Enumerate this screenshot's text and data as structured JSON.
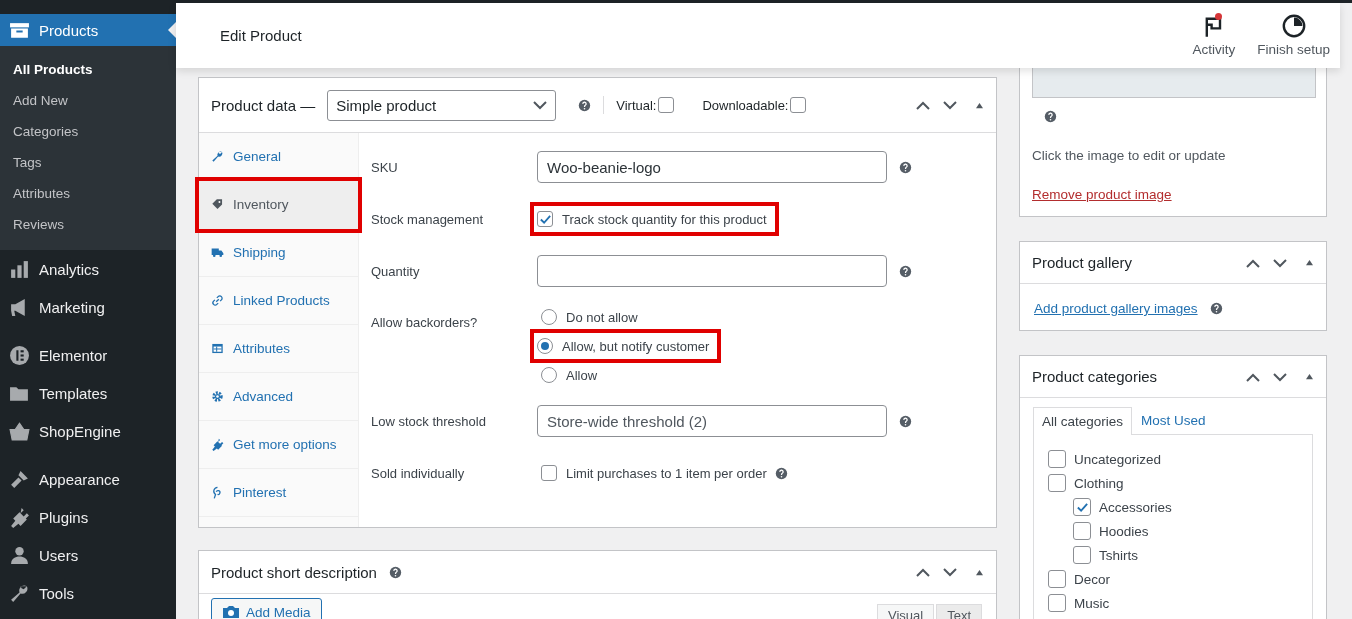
{
  "sidebar": {
    "groups": [
      {
        "items": [
          {
            "label": "Products",
            "selected": true,
            "submenu": [
              {
                "label": "All Products",
                "selected": true
              },
              {
                "label": "Add New",
                "selected": false
              },
              {
                "label": "Categories",
                "selected": false
              },
              {
                "label": "Tags",
                "selected": false
              },
              {
                "label": "Attributes",
                "selected": false
              },
              {
                "label": "Reviews",
                "selected": false
              }
            ]
          },
          {
            "label": "Analytics",
            "selected": false
          },
          {
            "label": "Marketing",
            "selected": false
          }
        ]
      },
      {
        "items": [
          {
            "label": "Elementor",
            "selected": false
          },
          {
            "label": "Templates",
            "selected": false
          },
          {
            "label": "ShopEngine",
            "selected": false
          }
        ]
      },
      {
        "items": [
          {
            "label": "Appearance",
            "selected": false
          },
          {
            "label": "Plugins",
            "selected": false
          },
          {
            "label": "Users",
            "selected": false
          },
          {
            "label": "Tools",
            "selected": false
          }
        ]
      }
    ]
  },
  "header": {
    "title": "Edit Product",
    "actions": [
      {
        "label": "Activity",
        "badge": true
      },
      {
        "label": "Finish setup",
        "badge": false
      }
    ]
  },
  "product_data": {
    "title": "Product data —",
    "type_select": "Simple product",
    "virtual": {
      "label": "Virtual:",
      "checked": false
    },
    "downloadable": {
      "label": "Downloadable:",
      "checked": false
    },
    "tabs": [
      {
        "label": "General",
        "selected": false,
        "highlighted": false
      },
      {
        "label": "Inventory",
        "selected": true,
        "highlighted": true
      },
      {
        "label": "Shipping",
        "selected": false,
        "highlighted": false
      },
      {
        "label": "Linked Products",
        "selected": false,
        "highlighted": false
      },
      {
        "label": "Attributes",
        "selected": false,
        "highlighted": false
      },
      {
        "label": "Advanced",
        "selected": false,
        "highlighted": false
      },
      {
        "label": "Get more options",
        "selected": false,
        "highlighted": false
      },
      {
        "label": "Pinterest",
        "selected": false,
        "highlighted": false
      }
    ],
    "fields": [
      {
        "kind": "text",
        "label": "SKU",
        "value": "Woo-beanie-logo",
        "help": true
      },
      {
        "kind": "checkbox",
        "label": "Stock management",
        "text": "Track stock quantity for this product",
        "checked": true,
        "highlighted": true,
        "help": false
      },
      {
        "kind": "text",
        "label": "Quantity",
        "help": true
      },
      {
        "kind": "radio",
        "label": "Allow backorders?",
        "options": [
          {
            "label": "Do not allow",
            "selected": false,
            "highlighted": false
          },
          {
            "label": "Allow, but notify customer",
            "selected": true,
            "highlighted": true
          },
          {
            "label": "Allow",
            "selected": false,
            "highlighted": false
          }
        ]
      },
      {
        "kind": "text",
        "label": "Low stock threshold",
        "placeholder": "Store-wide threshold (2)",
        "help": true
      },
      {
        "kind": "checkbox",
        "label": "Sold individually",
        "text": "Limit purchases to 1 item per order",
        "checked": false,
        "highlighted": false,
        "help": true
      }
    ]
  },
  "short_description": {
    "title": "Product short description",
    "add_media": "Add Media",
    "editor_tabs": [
      {
        "label": "Visual",
        "selected": false
      },
      {
        "label": "Text",
        "selected": true
      }
    ]
  },
  "product_image": {
    "caption": "Click the image to edit or update",
    "remove_link": "Remove product image"
  },
  "product_gallery": {
    "title": "Product gallery",
    "link": "Add product gallery images"
  },
  "product_categories": {
    "title": "Product categories",
    "tabs": [
      {
        "label": "All categories",
        "selected": true
      },
      {
        "label": "Most Used",
        "selected": false
      }
    ],
    "items": [
      {
        "label": "Uncategorized",
        "checked": false
      },
      {
        "label": "Clothing",
        "checked": false,
        "children": [
          {
            "label": "Accessories",
            "checked": true
          },
          {
            "label": "Hoodies",
            "checked": false
          },
          {
            "label": "Tshirts",
            "checked": false
          }
        ]
      },
      {
        "label": "Decor",
        "checked": false
      },
      {
        "label": "Music",
        "checked": false
      }
    ]
  }
}
